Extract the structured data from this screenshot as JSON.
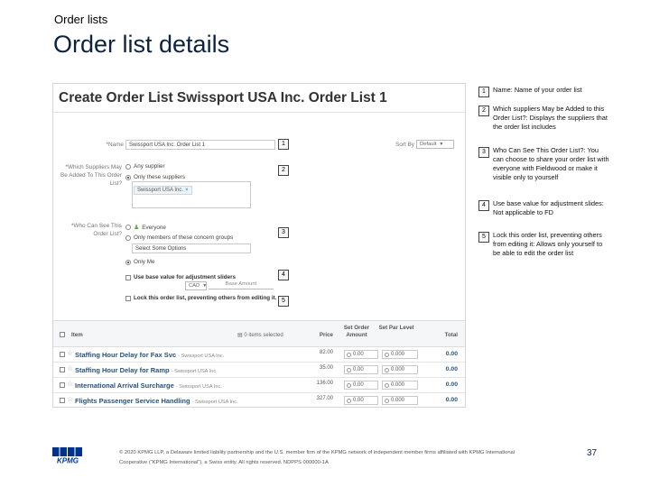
{
  "slide": {
    "subtitle": "Order lists",
    "title": "Order list details",
    "page_number": "37",
    "footnote": "© 2020 KPMG LLP, a Delaware limited liability partnership and the U.S. member firm of the KPMG network of independent member firms affiliated with KPMG International Cooperative (“KPMG International”), a Swiss entity. All rights reserved. NDPPS 000000-1A"
  },
  "form": {
    "title": "Create Order List Swissport USA Inc. Order List 1",
    "name_label": "Name",
    "name_value": "Swissport USA Inc. Order List 1",
    "sort_by_label": "Sort By",
    "sort_by_value": "Default",
    "suppliers_label": "Which Suppliers May Be Added To This Order List?",
    "supplier_options": [
      "Any supplier",
      "Only these suppliers"
    ],
    "supplier_tag": "Swissport USA Inc.",
    "who_label": "Who Can See This Order List?",
    "visibility_options": [
      "Everyone",
      "Only members of these concern groups",
      "Only Me"
    ],
    "group_select": "Select Some Options",
    "base_value_label": "Use base value for adjustment sliders",
    "currency": "CAD",
    "base_amount_placeholder": "Base Amount",
    "lock_label": "Lock this order list, preventing others from editing it."
  },
  "table": {
    "headers": {
      "item": "Item",
      "selected": "0 items selected",
      "price": "Price",
      "set_amount": "Set Order Amount",
      "set_level": "Set Par Level",
      "total": "Total"
    },
    "rows": [
      {
        "name": "Staffing Hour Delay for Fax Svc",
        "supplier": "- Swissport USA Inc.",
        "price": "82.00",
        "amount": "0.00",
        "level": "0.000",
        "total": "0.00"
      },
      {
        "name": "Staffing Hour Delay for Ramp",
        "supplier": "- Swissport USA Inc.",
        "price": "35.00",
        "amount": "0.00",
        "level": "0.000",
        "total": "0.00"
      },
      {
        "name": "International Arrival Surcharge",
        "supplier": "- Swissport USA Inc.",
        "price": "136.00",
        "amount": "0.00",
        "level": "0.000",
        "total": "0.00"
      },
      {
        "name": "Flights Passenger Service Handling",
        "supplier": "- Swissport USA Inc.",
        "price": "327.00",
        "amount": "0.00",
        "level": "0.000",
        "total": "0.00"
      }
    ]
  },
  "callouts": {
    "markers": [
      "1",
      "2",
      "3",
      "4",
      "5"
    ]
  },
  "legend": [
    {
      "num": "1",
      "text": "Name: Name of your order list"
    },
    {
      "num": "2",
      "text": "Which suppliers May be Added to this Order List?: Displays the suppliers that the order list includes"
    },
    {
      "num": "3",
      "text": "Who Can See This Order List?: You can choose to share your order list with everyone with Fieldwood or make it visible only to yourself"
    },
    {
      "num": "4",
      "text": "Use base value for adjustment slides: Not applicable to FD"
    },
    {
      "num": "5",
      "text": "Lock this order list, preventing others from editing it: Allows only yourself to be able to edit the order list"
    }
  ],
  "logo_text": "KPMG"
}
